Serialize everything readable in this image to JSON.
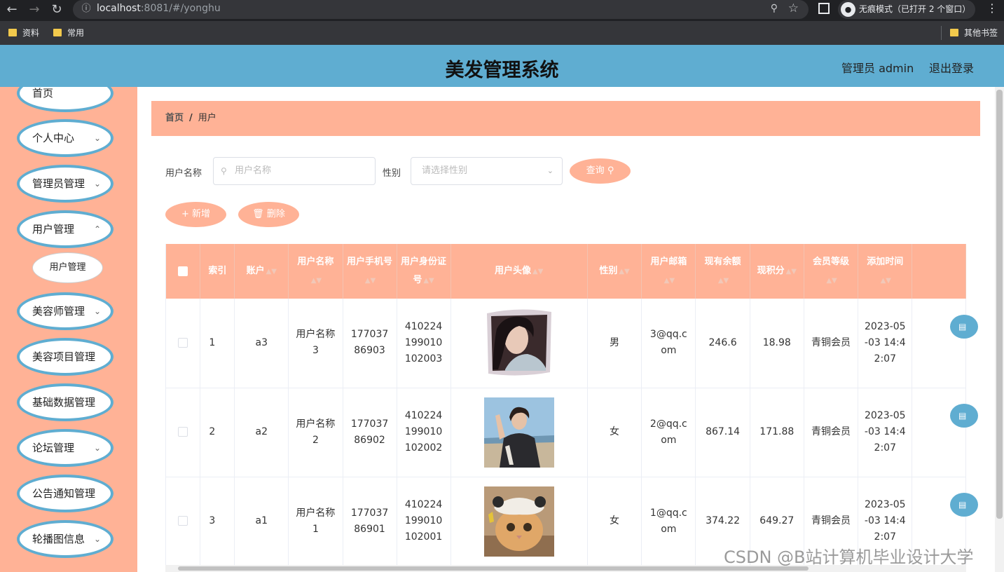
{
  "browser": {
    "url_host": "localhost",
    "url_rest": ":8081/#/yonghu",
    "incognito_label": "无痕模式（已打开 2 个窗口）",
    "bookmarks": [
      "资料",
      "常用"
    ],
    "other_bookmarks": "其他书签"
  },
  "header": {
    "title": "美发管理系统",
    "admin_label": "管理员 admin",
    "logout_label": "退出登录",
    "accent_color": "#5fadd1",
    "theme_color": "#ffb296"
  },
  "sidebar": {
    "items": [
      {
        "label": "首页",
        "has_chevron": false
      },
      {
        "label": "个人中心",
        "has_chevron": true
      },
      {
        "label": "管理员管理",
        "has_chevron": true
      },
      {
        "label": "用户管理",
        "has_chevron": true
      },
      {
        "label": "美容师管理",
        "has_chevron": true
      },
      {
        "label": "美容项目管理",
        "has_chevron": true
      },
      {
        "label": "基础数据管理",
        "has_chevron": true
      },
      {
        "label": "论坛管理",
        "has_chevron": true
      },
      {
        "label": "公告通知管理",
        "has_chevron": true
      },
      {
        "label": "轮播图信息",
        "has_chevron": true
      }
    ],
    "subitem": "用户管理"
  },
  "breadcrumb": {
    "home": "首页",
    "separator": "/",
    "current": "用户"
  },
  "search": {
    "name_label": "用户名称",
    "name_placeholder": "用户名称",
    "gender_label": "性别",
    "gender_placeholder": "请选择性别",
    "query_button": "查询"
  },
  "actions": {
    "add_button": "新增",
    "delete_button": "删除"
  },
  "table": {
    "columns": [
      "索引",
      "账户",
      "用户名称",
      "用户手机号",
      "用户身份证号",
      "用户头像",
      "性别",
      "用户邮箱",
      "现有余额",
      "现积分",
      "会员等级",
      "添加时间"
    ],
    "rows": [
      {
        "index": "1",
        "account": "a3",
        "name": "用户名称3",
        "phone": "17703786903",
        "id_card": "410224199010102003",
        "avatar": "portrait-woman",
        "gender": "男",
        "email": "3@qq.com",
        "balance": "246.6",
        "points": "18.98",
        "level": "青铜会员",
        "added": "2023-05-03 14:42:07"
      },
      {
        "index": "2",
        "account": "a2",
        "name": "用户名称2",
        "phone": "17703786902",
        "id_card": "410224199010102002",
        "avatar": "portrait-man-beach",
        "gender": "女",
        "email": "2@qq.com",
        "balance": "867.14",
        "points": "171.88",
        "level": "青铜会员",
        "added": "2023-05-03 14:42:07"
      },
      {
        "index": "3",
        "account": "a1",
        "name": "用户名称1",
        "phone": "17703786901",
        "id_card": "410224199010102001",
        "avatar": "cat-in-hat",
        "gender": "女",
        "email": "1@qq.com",
        "balance": "374.22",
        "points": "649.27",
        "level": "青铜会员",
        "added": "2023-05-03 14:42:07"
      }
    ]
  },
  "watermark": "CSDN @B站计算机毕业设计大学"
}
